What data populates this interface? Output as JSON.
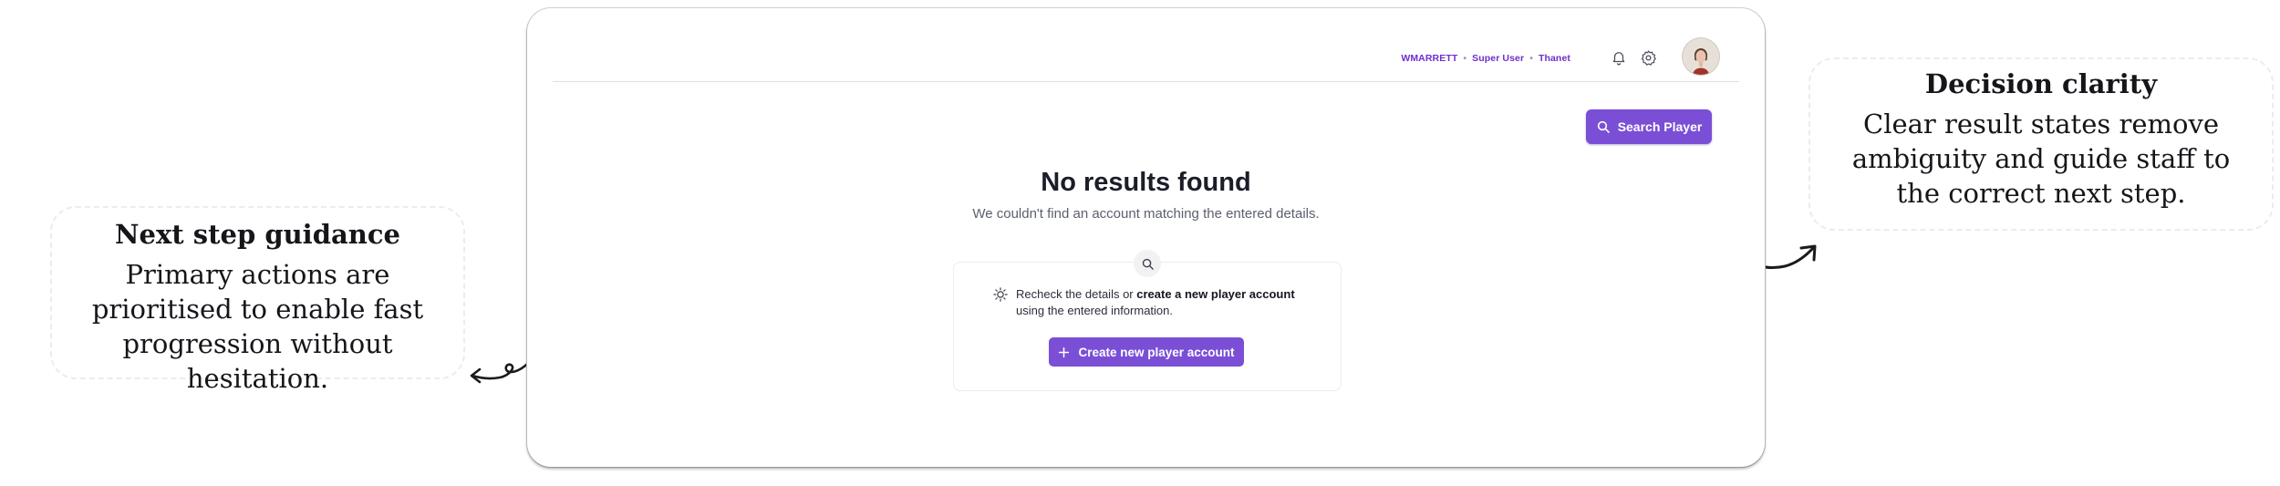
{
  "annotations": {
    "left": {
      "title": "Next step guidance",
      "body": "Primary actions are prioritised to enable fast progression without hesitation."
    },
    "right": {
      "title": "Decision clarity",
      "body": "Clear result states remove ambiguity and guide staff to the correct next step."
    }
  },
  "header": {
    "username": "WMARRETT",
    "role": "Super User",
    "location": "Thanet",
    "separator": "•"
  },
  "toolbar": {
    "search_label": "Search Player"
  },
  "empty_state": {
    "title": "No results found",
    "subtitle": "We couldn't find an account matching the entered details.",
    "tip_prefix": "Recheck the details or ",
    "tip_bold": "create a new player account",
    "tip_suffix": "using the entered information.",
    "create_label": "Create new player account"
  },
  "colors": {
    "accent": "#7a4fd6",
    "user_text": "#6e2fd0"
  },
  "icons": [
    "bell-icon",
    "gear-icon",
    "search-icon",
    "lightbulb-icon",
    "plus-icon",
    "avatar"
  ]
}
